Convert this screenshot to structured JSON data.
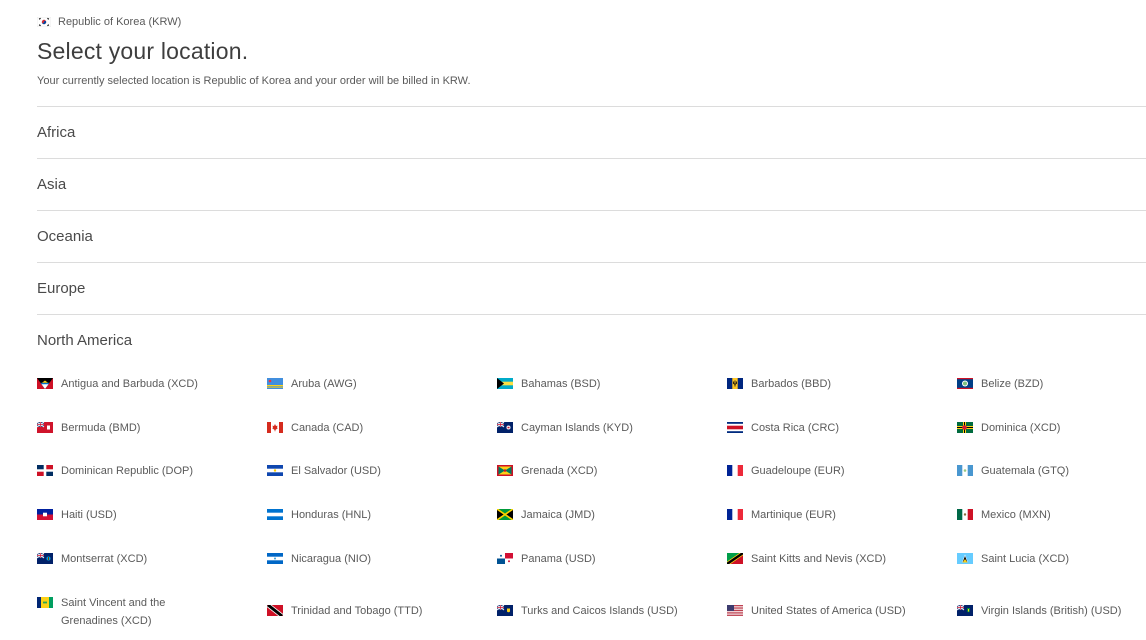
{
  "current_location": {
    "label": "Republic of Korea (KRW)",
    "flag_icon": "south-korea-flag-icon"
  },
  "title": "Select your location.",
  "subtitle": "Your currently selected location is Republic of Korea and your order will be billed in KRW.",
  "regions": [
    {
      "label": "Africa"
    },
    {
      "label": "Asia"
    },
    {
      "label": "Oceania"
    },
    {
      "label": "Europe"
    },
    {
      "label": "North America"
    }
  ],
  "countries": [
    {
      "label": "Antigua and Barbuda (XCD)",
      "flag_icon": "antigua-and-barbuda-flag-icon"
    },
    {
      "label": "Aruba (AWG)",
      "flag_icon": "aruba-flag-icon"
    },
    {
      "label": "Bahamas (BSD)",
      "flag_icon": "bahamas-flag-icon"
    },
    {
      "label": "Barbados (BBD)",
      "flag_icon": "barbados-flag-icon"
    },
    {
      "label": "Belize (BZD)",
      "flag_icon": "belize-flag-icon"
    },
    {
      "label": "Bermuda (BMD)",
      "flag_icon": "bermuda-flag-icon"
    },
    {
      "label": "Canada (CAD)",
      "flag_icon": "canada-flag-icon"
    },
    {
      "label": "Cayman Islands (KYD)",
      "flag_icon": "cayman-islands-flag-icon"
    },
    {
      "label": "Costa Rica (CRC)",
      "flag_icon": "costa-rica-flag-icon"
    },
    {
      "label": "Dominica (XCD)",
      "flag_icon": "dominica-flag-icon"
    },
    {
      "label": "Dominican Republic (DOP)",
      "flag_icon": "dominican-republic-flag-icon"
    },
    {
      "label": "El Salvador (USD)",
      "flag_icon": "el-salvador-flag-icon"
    },
    {
      "label": "Grenada (XCD)",
      "flag_icon": "grenada-flag-icon"
    },
    {
      "label": "Guadeloupe (EUR)",
      "flag_icon": "guadeloupe-flag-icon"
    },
    {
      "label": "Guatemala (GTQ)",
      "flag_icon": "guatemala-flag-icon"
    },
    {
      "label": "Haiti (USD)",
      "flag_icon": "haiti-flag-icon"
    },
    {
      "label": "Honduras (HNL)",
      "flag_icon": "honduras-flag-icon"
    },
    {
      "label": "Jamaica (JMD)",
      "flag_icon": "jamaica-flag-icon"
    },
    {
      "label": "Martinique (EUR)",
      "flag_icon": "martinique-flag-icon"
    },
    {
      "label": "Mexico (MXN)",
      "flag_icon": "mexico-flag-icon"
    },
    {
      "label": "Montserrat (XCD)",
      "flag_icon": "montserrat-flag-icon"
    },
    {
      "label": "Nicaragua (NIO)",
      "flag_icon": "nicaragua-flag-icon"
    },
    {
      "label": "Panama (USD)",
      "flag_icon": "panama-flag-icon"
    },
    {
      "label": "Saint Kitts and Nevis (XCD)",
      "flag_icon": "saint-kitts-and-nevis-flag-icon"
    },
    {
      "label": "Saint Lucia (XCD)",
      "flag_icon": "saint-lucia-flag-icon"
    },
    {
      "label": "Saint Vincent and the Grenadines (XCD)",
      "flag_icon": "saint-vincent-and-the-grenadines-flag-icon"
    },
    {
      "label": "Trinidad and Tobago (TTD)",
      "flag_icon": "trinidad-and-tobago-flag-icon"
    },
    {
      "label": "Turks and Caicos Islands (USD)",
      "flag_icon": "turks-and-caicos-islands-flag-icon"
    },
    {
      "label": "United States of America (USD)",
      "flag_icon": "united-states-flag-icon"
    },
    {
      "label": "Virgin Islands (British) (USD)",
      "flag_icon": "british-virgin-islands-flag-icon"
    }
  ]
}
